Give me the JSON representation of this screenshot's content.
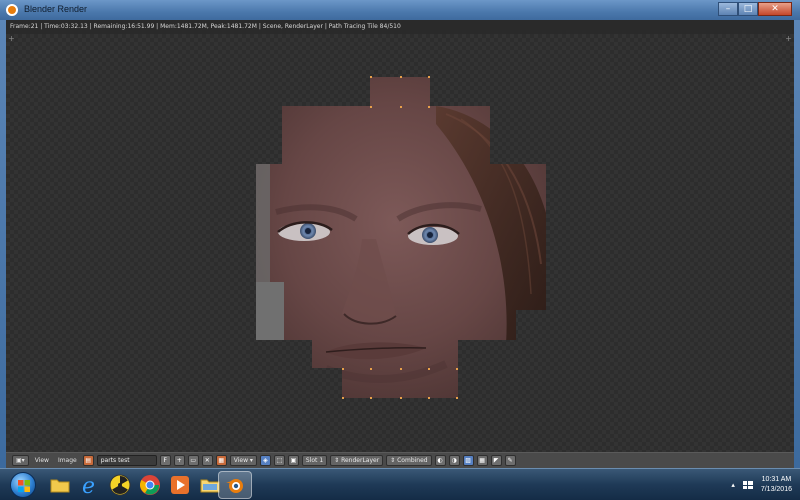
{
  "window": {
    "title": "Blender Render",
    "controls": {
      "minimize": "–",
      "maximize": "□",
      "close": "✕"
    }
  },
  "render_info": "Frame:21 | Time:03:32.13 | Remaining:16:51.99 | Mem:1481.72M, Peak:1481.72M | Scene, RenderLayer | Path Tracing Tile 84/510",
  "editor_header": {
    "editor_type_icon": "image-editor-icon",
    "menu_view": "View",
    "menu_image": "Image",
    "image_name": "parts test",
    "view_label": "View",
    "slot": "Slot 1",
    "render_layer": "RenderLayer",
    "pass": "Combined"
  },
  "taskbar": {
    "pinned": [
      {
        "name": "explorer",
        "icon": "folder-icon"
      },
      {
        "name": "internet-explorer",
        "icon": "ie-icon"
      },
      {
        "name": "app-radiation",
        "icon": "radiation-icon"
      },
      {
        "name": "chrome",
        "icon": "chrome-icon"
      },
      {
        "name": "media-player",
        "icon": "media-player-icon"
      },
      {
        "name": "folder-2",
        "icon": "folder-icon"
      },
      {
        "name": "blender",
        "icon": "blender-icon"
      }
    ],
    "tray": {
      "time": "10:31 AM",
      "date": "7/13/2016"
    }
  },
  "colors": {
    "skin": "#6e4f4e",
    "hair": "#4a3128",
    "viewport_bg": "#333333",
    "accent": "#e87d0d"
  }
}
